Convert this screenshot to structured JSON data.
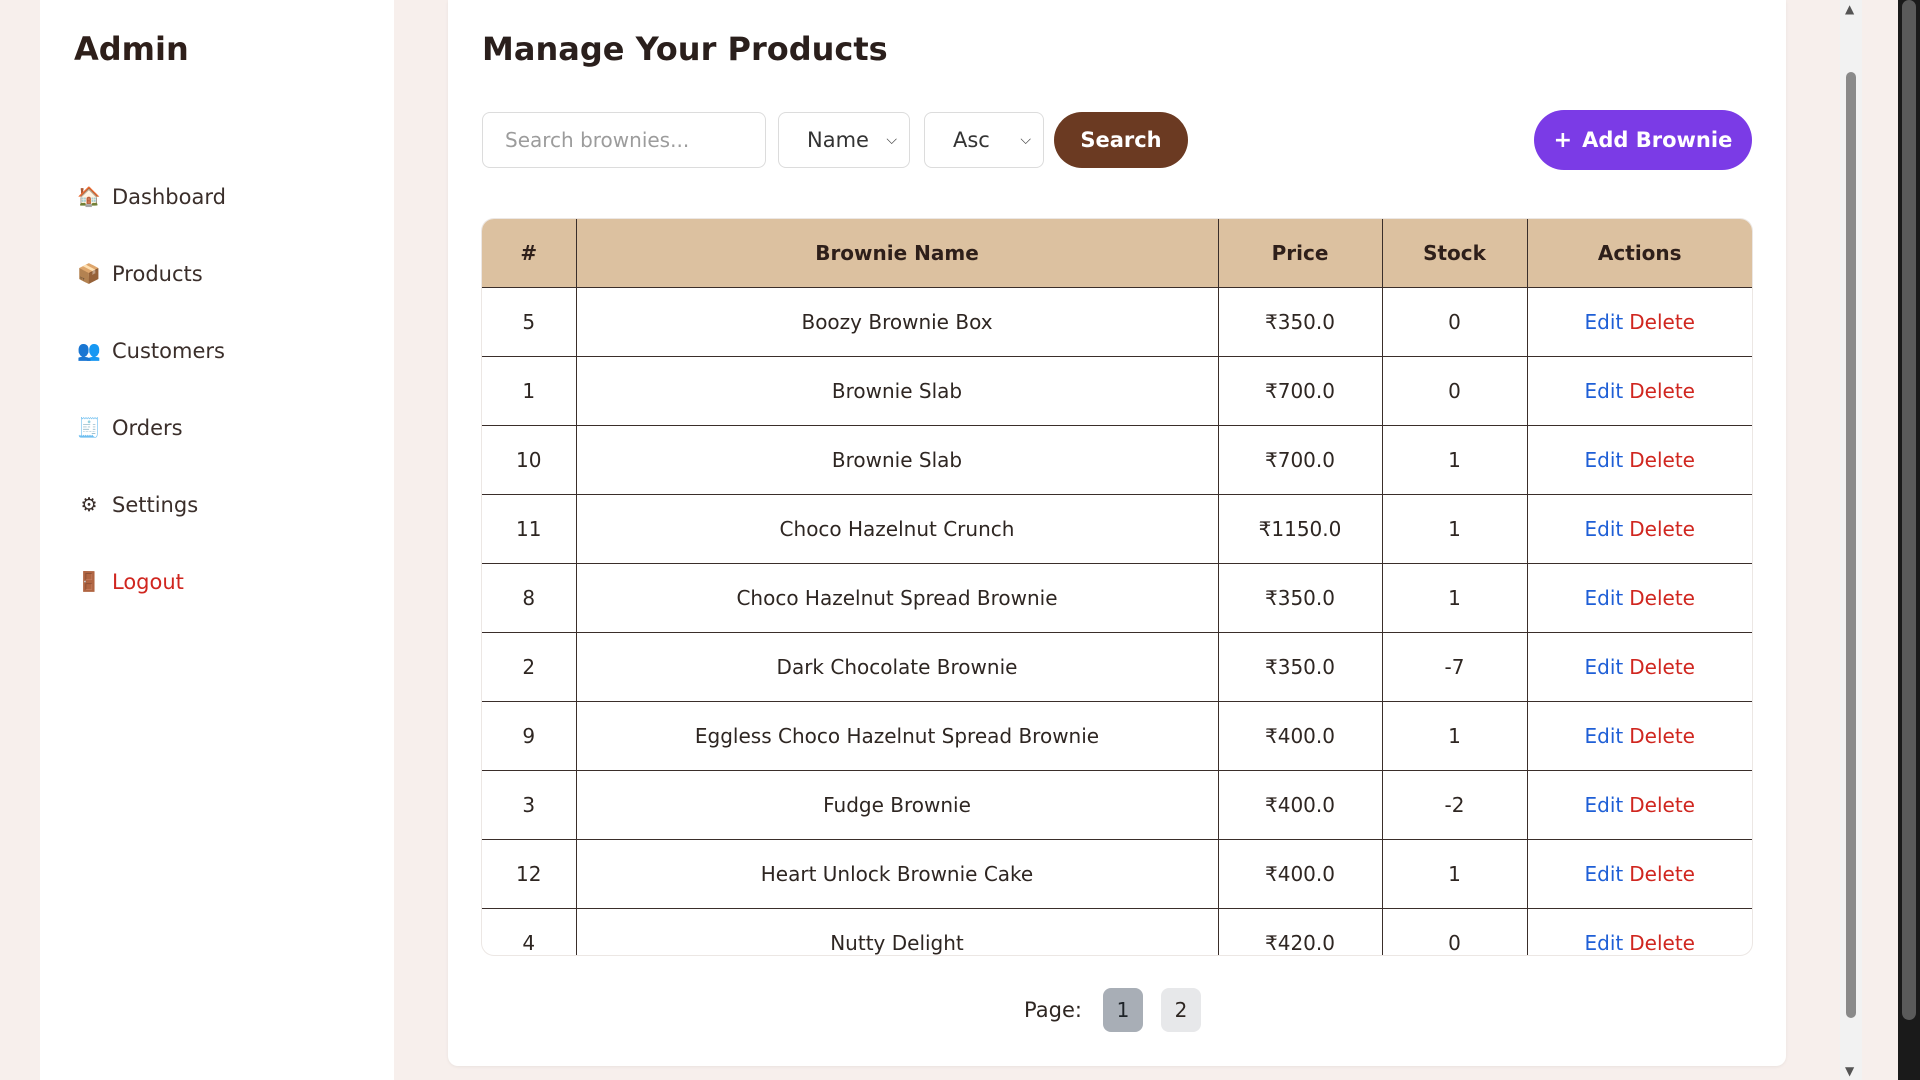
{
  "sidebar": {
    "brand": "Admin",
    "items": [
      {
        "icon": "🏠",
        "icon_name": "house-icon",
        "label": "Dashboard"
      },
      {
        "icon": "📦",
        "icon_name": "package-icon",
        "label": "Products"
      },
      {
        "icon": "👥",
        "icon_name": "users-icon",
        "label": "Customers"
      },
      {
        "icon": "🧾",
        "icon_name": "receipt-icon",
        "label": "Orders"
      },
      {
        "icon": "⚙",
        "icon_name": "gear-icon",
        "label": "Settings"
      },
      {
        "icon": "🚪",
        "icon_name": "door-icon",
        "label": "Logout"
      }
    ]
  },
  "main": {
    "title": "Manage Your Products",
    "search": {
      "placeholder": "Search brownies...",
      "button_label": "Search"
    },
    "sort_field": {
      "selected": "Name"
    },
    "sort_order": {
      "selected": "Asc"
    },
    "add_button": {
      "icon": "+",
      "label": "Add Brownie"
    }
  },
  "table": {
    "headers": [
      "#",
      "Brownie Name",
      "Price",
      "Stock",
      "Actions"
    ],
    "rows": [
      {
        "id": "5",
        "name": "Boozy Brownie Box",
        "price": "₹350.0",
        "stock": "0"
      },
      {
        "id": "1",
        "name": "Brownie Slab",
        "price": "₹700.0",
        "stock": "0"
      },
      {
        "id": "10",
        "name": "Brownie Slab",
        "price": "₹700.0",
        "stock": "1"
      },
      {
        "id": "11",
        "name": "Choco Hazelnut Crunch",
        "price": "₹1150.0",
        "stock": "1"
      },
      {
        "id": "8",
        "name": "Choco Hazelnut Spread Brownie",
        "price": "₹350.0",
        "stock": "1"
      },
      {
        "id": "2",
        "name": "Dark Chocolate Brownie",
        "price": "₹350.0",
        "stock": "-7"
      },
      {
        "id": "9",
        "name": "Eggless Choco Hazelnut Spread Brownie",
        "price": "₹400.0",
        "stock": "1"
      },
      {
        "id": "3",
        "name": "Fudge Brownie",
        "price": "₹400.0",
        "stock": "-2"
      },
      {
        "id": "12",
        "name": "Heart Unlock Brownie Cake",
        "price": "₹400.0",
        "stock": "1"
      },
      {
        "id": "4",
        "name": "Nutty Delight",
        "price": "₹420.0",
        "stock": "0"
      }
    ],
    "edit_label": "Edit",
    "delete_label": "Delete"
  },
  "pagination": {
    "label": "Page:",
    "pages": [
      "1",
      "2"
    ],
    "current": "1"
  },
  "colors": {
    "header_bg": "#dcc1a0",
    "search_button": "#6b3a22",
    "add_button": "#7b3be6",
    "edit_link": "#1f5fd6",
    "delete_link": "#d0261f"
  }
}
